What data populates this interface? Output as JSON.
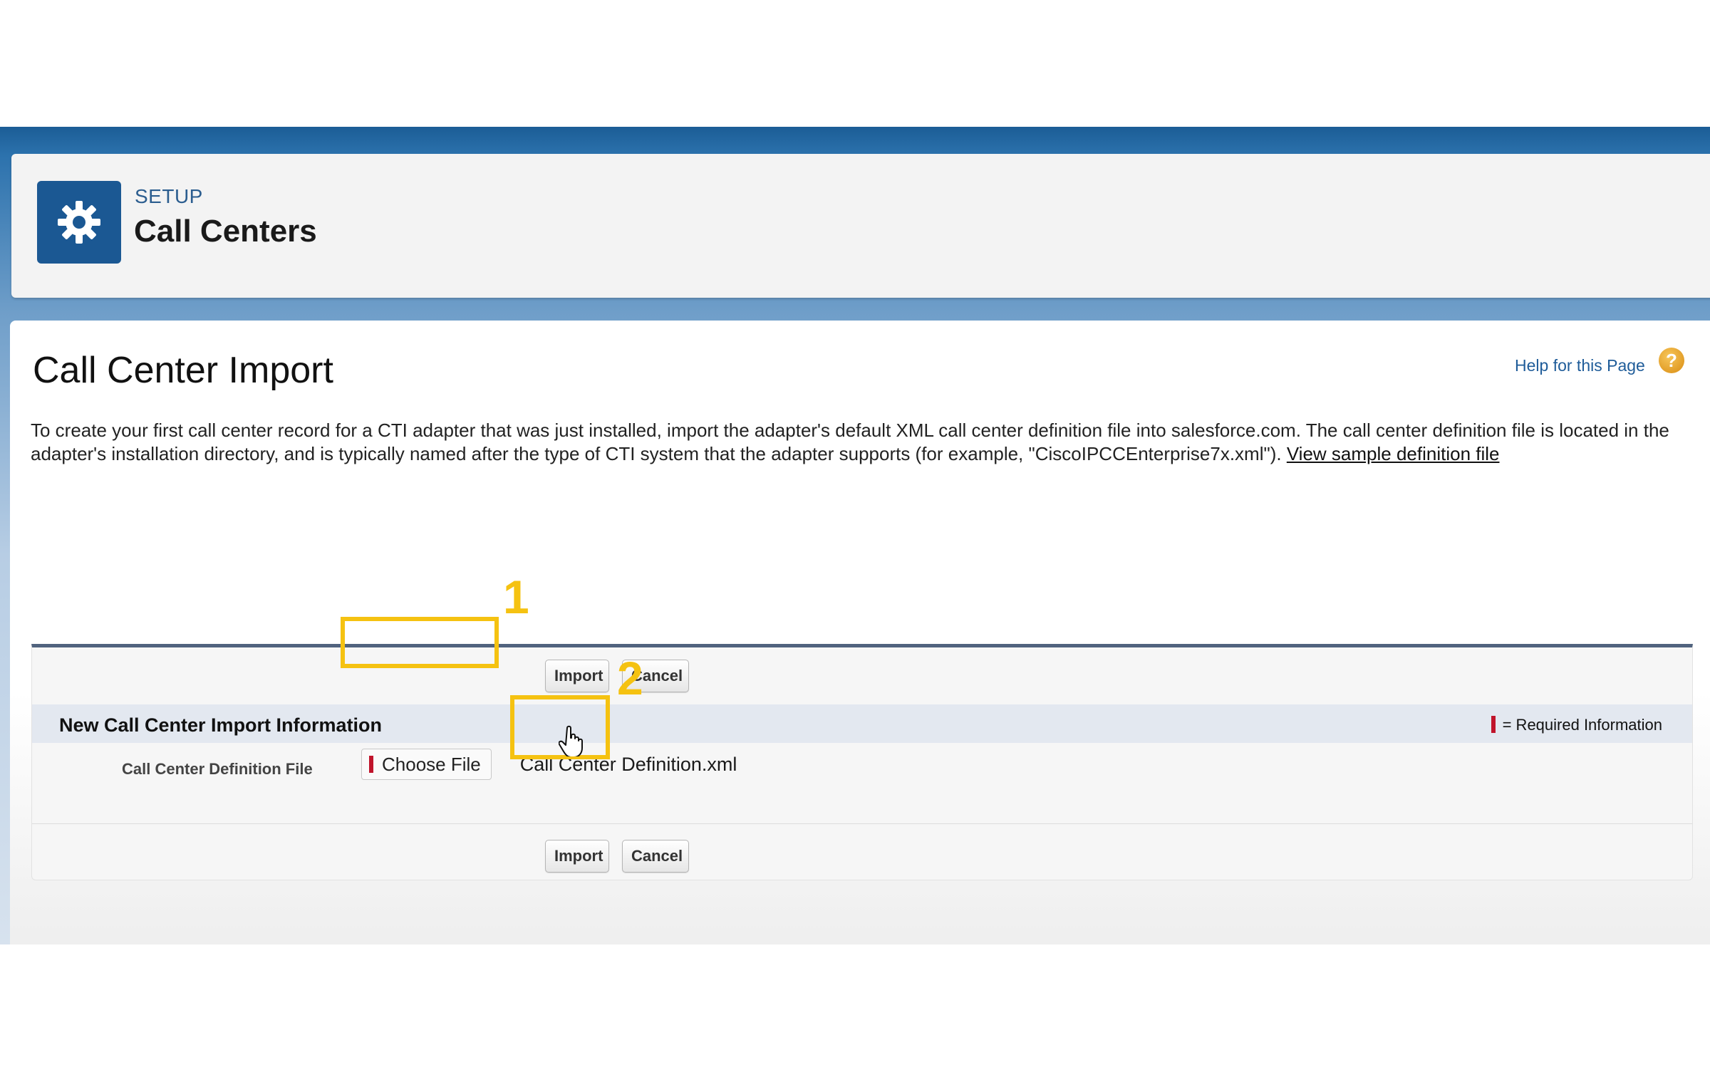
{
  "header": {
    "kicker": "SETUP",
    "title": "Call Centers",
    "icon": "gear-icon"
  },
  "page": {
    "title": "Call Center Import",
    "help_link": "Help for this Page",
    "help_icon": "question-icon",
    "description_text": "To create your first call center record for a CTI adapter that was just installed, import the adapter's default XML call center definition file into salesforce.com. The call center definition file is located in the adapter's installation directory, and is typically named after the type of CTI system that the adapter supports (for example, \"CiscoIPCCEnterprise7x.xml\"). ",
    "description_link": "View sample definition file"
  },
  "form": {
    "import_label": "Import",
    "cancel_label": "Cancel",
    "section_title": "New Call Center Import Information",
    "required_legend": "= Required Information",
    "field_label": "Call Center Definition File",
    "choose_file_label": "Choose File",
    "selected_file": "Call Center Definition.xml"
  },
  "annotations": {
    "step1": "1",
    "step2": "2",
    "highlight_color": "#f5c211"
  },
  "colors": {
    "brand_blue": "#1b5893",
    "required_red": "#c0142b",
    "link_blue": "#1f5c99"
  }
}
